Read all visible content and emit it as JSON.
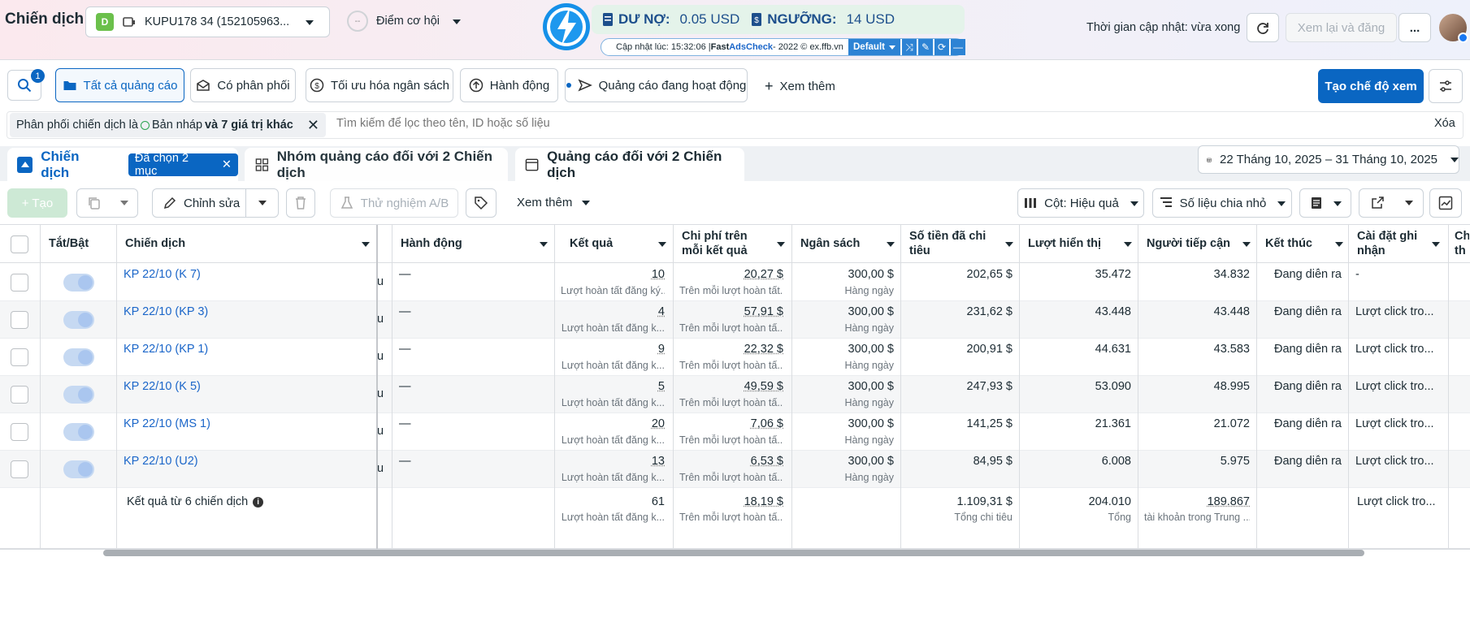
{
  "header": {
    "title": "Chiến dịch",
    "account_badge": "D",
    "account_name": "KUPU178 34 (152105963...",
    "opportunity_label": "Điểm cơ hội",
    "opportunity_badge": "--",
    "update_time": "Thời gian cập nhật: vừa xong",
    "review_publish": "Xem lại và đăng",
    "more": "..."
  },
  "adscheck": {
    "debt_label": "DƯ NỢ:",
    "debt_value": "0.05 USD",
    "threshold_label": "NGƯỠNG:",
    "threshold_value": "14 USD",
    "updated": "Cập nhật lúc: 15:32:06 | ",
    "brand_fast": "Fast ",
    "brand_name": "AdsCheck",
    "brand_tail": " - 2022 © ex.ffb.vn",
    "profile": "Default"
  },
  "filters": {
    "search_badge": "1",
    "tabs": [
      "Tất cả quảng cáo",
      "Có phân phối",
      "Tối ưu hóa ngân sách",
      "Hành động",
      "Quảng cáo đang hoạt động"
    ],
    "more": "Xem thêm",
    "create_view": "Tạo chế độ xem",
    "chip_prefix": "Phân phối chiến dịch là ",
    "chip_draft": "Bản nháp",
    "chip_suffix": " và 7 giá trị khác",
    "search_placeholder": "Tìm kiếm để lọc theo tên, ID hoặc số liệu",
    "clear": "Xóa"
  },
  "level_tabs": {
    "campaign": "Chiến dịch",
    "selected": "Đã chọn 2 mục",
    "adsets": "Nhóm quảng cáo đối với 2 Chiến dịch",
    "ads": "Quảng cáo đối với 2 Chiến dịch",
    "date_range": "22 Tháng 10, 2025 – 31 Tháng 10, 2025"
  },
  "toolbar": {
    "create": "+ Tạo",
    "edit": "Chỉnh sửa",
    "ab_test": "Thử nghiệm A/B",
    "more": "Xem thêm",
    "columns": "Cột: Hiệu quả",
    "breakdown": "Số liệu chia nhỏ"
  },
  "table": {
    "headers": {
      "toggle": "Tắt/Bật",
      "campaign": "Chiến dịch",
      "action": "Hành động",
      "result": "Kết quả",
      "cost_per_result": "Chi phí trên mỗi kết quả",
      "budget": "Ngân sách",
      "spent": "Số tiền đã chi tiêu",
      "impressions": "Lượt hiển thị",
      "reach": "Người tiếp cận",
      "end": "Kết thúc",
      "attribution": "Cài đặt ghi nhận",
      "next": "Ch th"
    },
    "rows": [
      {
        "name": "KP 22/10 (K 7)",
        "partial": "u",
        "action": "—",
        "result": "10",
        "result_sub": "Lượt hoàn tất đăng ký...",
        "cpr": "20,27 $",
        "cpr_sub": "Trên mỗi lượt hoàn tất...",
        "budget": "300,00 $",
        "budget_sub": "Hàng ngày",
        "spent": "202,65 $",
        "impr": "35.472",
        "reach": "34.832",
        "end": "Đang diễn ra",
        "attr": "-"
      },
      {
        "name": "KP 22/10 (KP 3)",
        "partial": "u",
        "action": "—",
        "result": "4",
        "result_sub": "Lượt hoàn tất đăng k...",
        "cpr": "57,91 $",
        "cpr_sub": "Trên mỗi lượt hoàn tấ...",
        "budget": "300,00 $",
        "budget_sub": "Hàng ngày",
        "spent": "231,62 $",
        "impr": "43.448",
        "reach": "43.448",
        "end": "Đang diễn ra",
        "attr": "Lượt click tro..."
      },
      {
        "name": "KP 22/10 (KP 1)",
        "partial": "u",
        "action": "—",
        "result": "9",
        "result_sub": "Lượt hoàn tất đăng k...",
        "cpr": "22,32 $",
        "cpr_sub": "Trên mỗi lượt hoàn tấ...",
        "budget": "300,00 $",
        "budget_sub": "Hàng ngày",
        "spent": "200,91 $",
        "impr": "44.631",
        "reach": "43.583",
        "end": "Đang diễn ra",
        "attr": "Lượt click tro..."
      },
      {
        "name": "KP 22/10 (K 5)",
        "partial": "u",
        "action": "—",
        "result": "5",
        "result_sub": "Lượt hoàn tất đăng k...",
        "cpr": "49,59 $",
        "cpr_sub": "Trên mỗi lượt hoàn tấ...",
        "budget": "300,00 $",
        "budget_sub": "Hàng ngày",
        "spent": "247,93 $",
        "impr": "53.090",
        "reach": "48.995",
        "end": "Đang diễn ra",
        "attr": "Lượt click tro..."
      },
      {
        "name": "KP 22/10 (MS 1)",
        "partial": "u",
        "action": "—",
        "result": "20",
        "result_sub": "Lượt hoàn tất đăng k...",
        "cpr": "7,06 $",
        "cpr_sub": "Trên mỗi lượt hoàn tấ...",
        "budget": "300,00 $",
        "budget_sub": "Hàng ngày",
        "spent": "141,25 $",
        "impr": "21.361",
        "reach": "21.072",
        "end": "Đang diễn ra",
        "attr": "Lượt click tro..."
      },
      {
        "name": "KP 22/10 (U2)",
        "partial": "u",
        "action": "—",
        "result": "13",
        "result_sub": "Lượt hoàn tất đăng k...",
        "cpr": "6,53 $",
        "cpr_sub": "Trên mỗi lượt hoàn tấ...",
        "budget": "300,00 $",
        "budget_sub": "Hàng ngày",
        "spent": "84,95 $",
        "impr": "6.008",
        "reach": "5.975",
        "end": "Đang diễn ra",
        "attr": "Lượt click tro..."
      }
    ],
    "totals": {
      "label": "Kết quả từ 6 chiến dịch",
      "result": "61",
      "result_sub": "Lượt hoàn tất đăng k...",
      "cpr": "18,19 $",
      "cpr_sub": "Trên mỗi lượt hoàn tấ...",
      "spent": "1.109,31 $",
      "spent_sub": "Tổng chi tiêu",
      "impr": "204.010",
      "impr_sub": "Tổng",
      "reach": "189.867",
      "reach_sub": "tài khoản trong Trung ...",
      "attr": "Lượt click tro..."
    }
  },
  "colors": {
    "primary": "#0a66c2",
    "link": "#1b66c9"
  }
}
